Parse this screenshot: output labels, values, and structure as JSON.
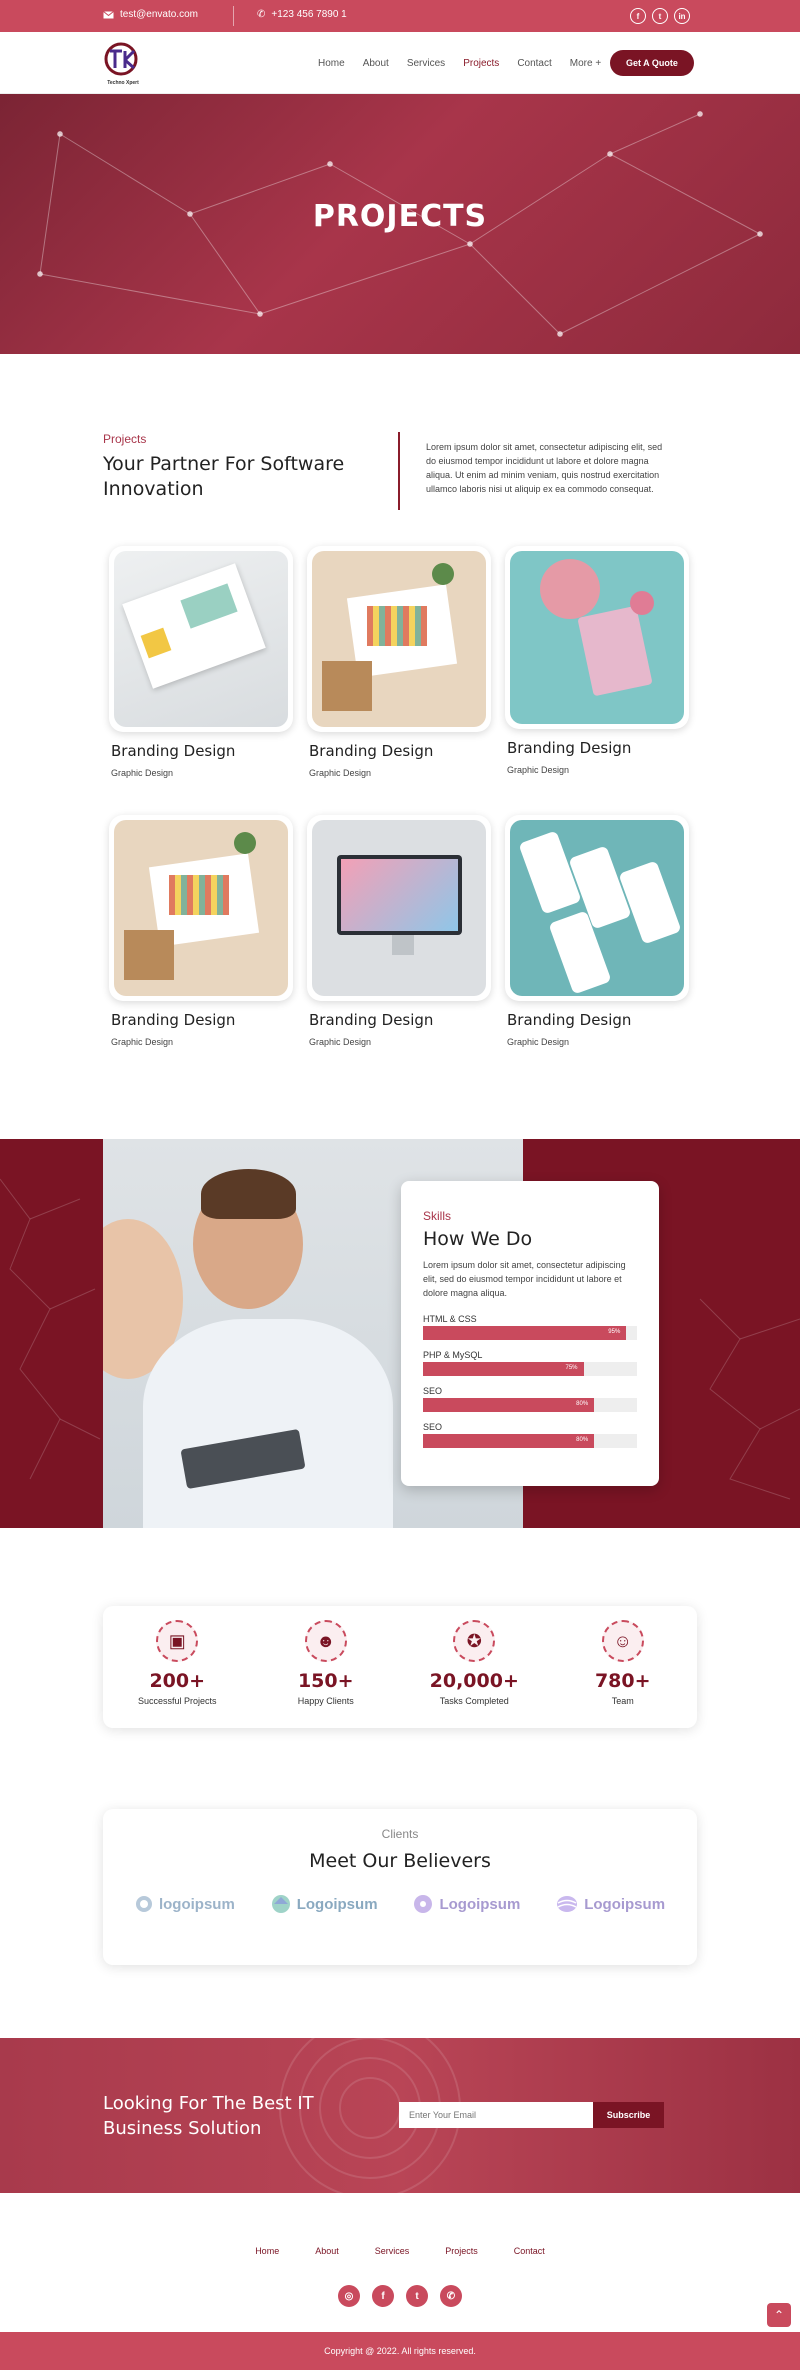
{
  "topbar": {
    "email": "test@envato.com",
    "phone": "+123 456 7890 1"
  },
  "brand": {
    "logo_text": "Techno Xpert"
  },
  "nav": {
    "items": [
      "Home",
      "About",
      "Services",
      "Projects",
      "Contact",
      "More +"
    ],
    "active": "Projects",
    "cta": "Get A Quote"
  },
  "hero": {
    "title": "PROJECTS"
  },
  "projects": {
    "eyebrow": "Projects",
    "title": "Your Partner For Software Innovation",
    "description": "Lorem ipsum dolor sit amet, consectetur adipiscing elit, sed do eiusmod tempor incididunt ut labore et dolore magna aliqua. Ut enim ad minim veniam, quis nostrud exercitation ullamco laboris nisi ut aliquip ex ea commodo consequat.",
    "cards": [
      {
        "title": "Branding Design",
        "subtitle": "Graphic Design"
      },
      {
        "title": "Branding Design",
        "subtitle": "Graphic Design"
      },
      {
        "title": "Branding Design",
        "subtitle": "Graphic Design"
      },
      {
        "title": "Branding Design",
        "subtitle": "Graphic Design"
      },
      {
        "title": "Branding Design",
        "subtitle": "Graphic Design"
      },
      {
        "title": "Branding Design",
        "subtitle": "Graphic Design"
      }
    ]
  },
  "skills": {
    "eyebrow": "Skills",
    "title": "How We Do",
    "description": "Lorem ipsum dolor sit amet, consectetur adipiscing elit, sed do eiusmod tempor incididunt ut labore et dolore magna aliqua.",
    "bars": [
      {
        "label": "HTML & CSS",
        "value": 95,
        "text": "95%"
      },
      {
        "label": "PHP & MySQL",
        "value": 75,
        "text": "75%"
      },
      {
        "label": "SEO",
        "value": 80,
        "text": "80%"
      },
      {
        "label": "SEO",
        "value": 80,
        "text": "80%"
      }
    ]
  },
  "stats": [
    {
      "icon": "briefcase-icon",
      "number": "200+",
      "label": "Successful Projects"
    },
    {
      "icon": "client-icon",
      "number": "150+",
      "label": "Happy Clients"
    },
    {
      "icon": "award-icon",
      "number": "20,000+",
      "label": "Tasks Completed"
    },
    {
      "icon": "team-icon",
      "number": "780+",
      "label": "Team"
    }
  ],
  "clients": {
    "eyebrow": "Clients",
    "title": "Meet Our Believers",
    "logos": [
      "logoipsum",
      "Logoipsum",
      "Logoipsum",
      "Logoipsum"
    ]
  },
  "newsletter": {
    "title": "Looking For The Best IT Business Solution",
    "placeholder": "Enter Your Email",
    "button": "Subscribe"
  },
  "footer": {
    "links": [
      "Home",
      "About",
      "Services",
      "Projects",
      "Contact"
    ],
    "copyright": "Copyright @ 2022. All rights reserved."
  },
  "colors": {
    "primary": "#c94a5d",
    "dark": "#7a1424"
  }
}
